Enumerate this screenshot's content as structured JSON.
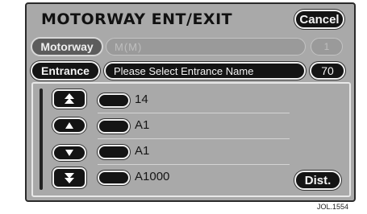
{
  "header": {
    "title": "MOTORWAY ENT/EXIT",
    "cancel_label": "Cancel"
  },
  "motorway": {
    "label": "Motorway",
    "value": "M(M)",
    "number": "1"
  },
  "entrance": {
    "label": "Entrance",
    "placeholder": "Please Select Entrance Name",
    "count": "70"
  },
  "nav_icons": [
    "page-up-icon",
    "scroll-up-icon",
    "scroll-down-icon",
    "page-down-icon"
  ],
  "list": {
    "items": [
      {
        "label": "14"
      },
      {
        "label": "A1"
      },
      {
        "label": "A1"
      },
      {
        "label": "A1000"
      }
    ]
  },
  "dist_label": "Dist.",
  "caption": "JOL.1554",
  "colors": {
    "screen_bg": "#a9a9a9",
    "button_dark": "#141414",
    "button_border": "#f0f0f0"
  }
}
